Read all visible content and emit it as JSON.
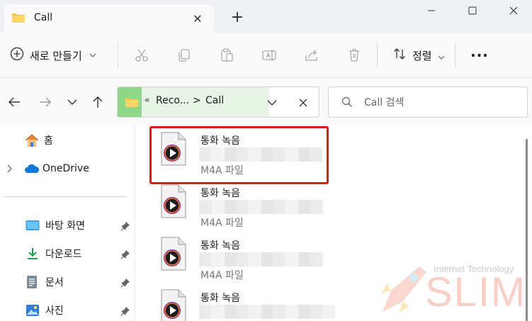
{
  "window": {
    "tab_title": "Call",
    "new_tab": "+"
  },
  "toolbar": {
    "new_label": "새로 만들기",
    "sort_label": "정렬",
    "more_label": "···"
  },
  "address": {
    "chevrons": "«",
    "crumb1": "Reco...",
    "crumb_sep": ">",
    "crumb2": "Call"
  },
  "search": {
    "placeholder": "Call 검색"
  },
  "sidebar": {
    "home": "홈",
    "onedrive": "OneDrive",
    "pinned": [
      {
        "label": "바탕 화면"
      },
      {
        "label": "다운로드"
      },
      {
        "label": "문서"
      },
      {
        "label": "사진"
      }
    ]
  },
  "files": [
    {
      "name": "통화 녹음",
      "type": "M4A 파일"
    },
    {
      "name": "통화 녹음",
      "type": "M4A 파일"
    },
    {
      "name": "통화 녹음",
      "type": "M4A 파일"
    },
    {
      "name": "통화 녹음",
      "type": ""
    }
  ],
  "watermark": {
    "tagline": "Internet Technology",
    "brand": "SLIM"
  },
  "colors": {
    "highlight": "#e01818",
    "folder": "#f5c34d",
    "address_accent": "#8fd88a",
    "onedrive": "#0f78d4"
  }
}
